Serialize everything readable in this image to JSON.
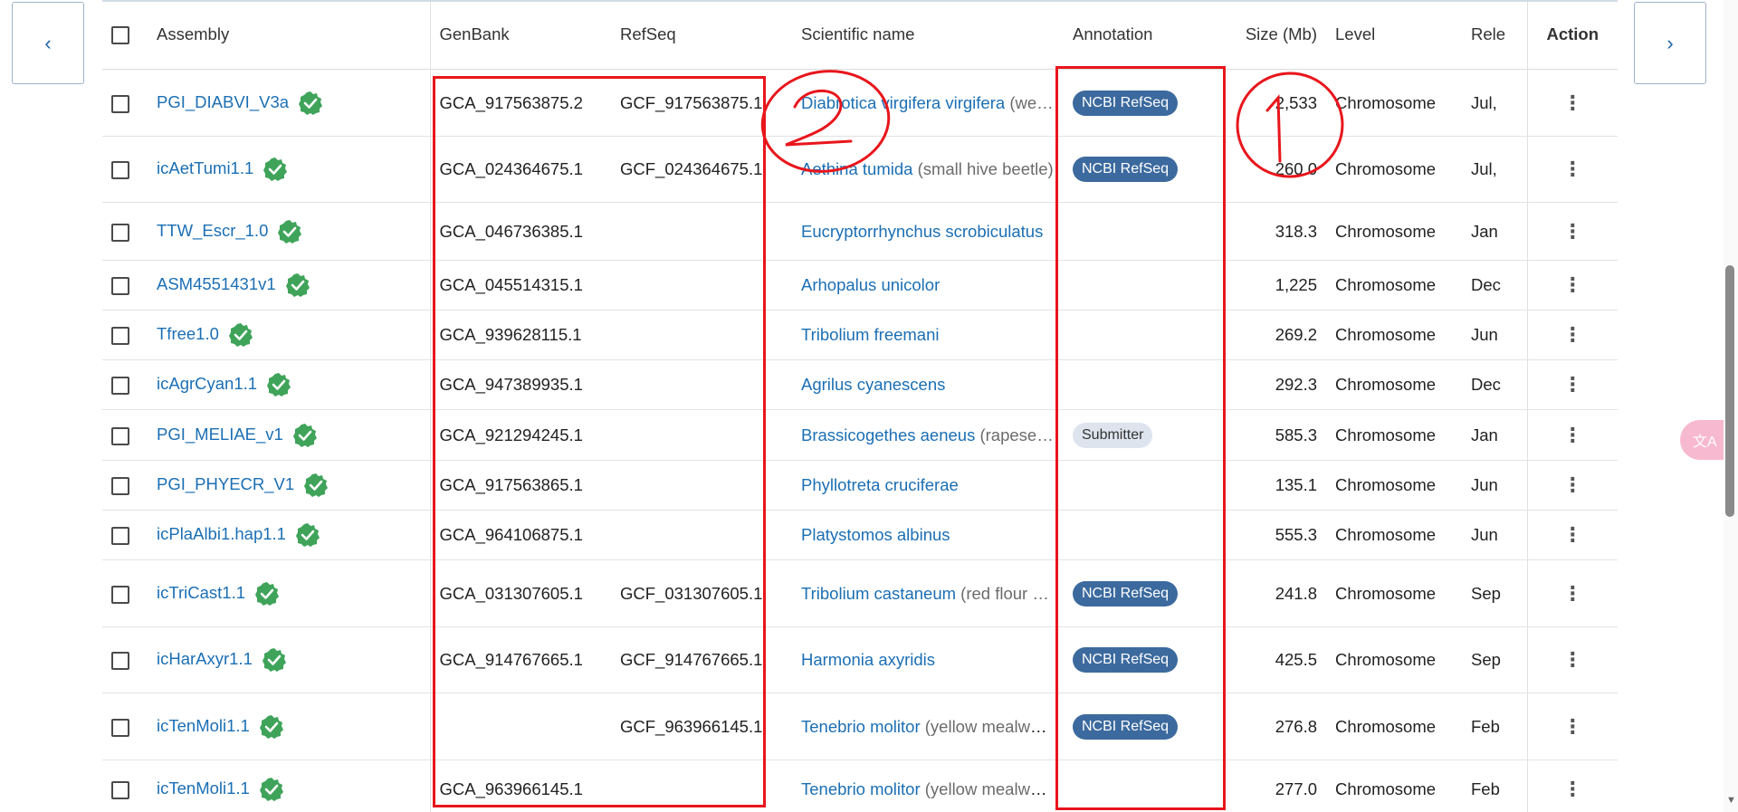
{
  "nav": {
    "prev_icon": "‹",
    "next_icon": "›"
  },
  "columns": {
    "assembly": "Assembly",
    "genbank": "GenBank",
    "refseq": "RefSeq",
    "scientific_name": "Scientific name",
    "annotation": "Annotation",
    "size": "Size (Mb)",
    "level": "Level",
    "release": "Rele",
    "action": "Action"
  },
  "rows": [
    {
      "assembly": "PGI_DIABVI_V3a",
      "genbank": "GCA_917563875.2",
      "refseq": "GCF_917563875.1",
      "sci": "Diabrotica virgifera virgifera",
      "common": "(we…",
      "annotation": "NCBI RefSeq",
      "size": "2,533",
      "level": "Chromosome",
      "release": "Jul,"
    },
    {
      "assembly": "icAetTumi1.1",
      "genbank": "GCA_024364675.1",
      "refseq": "GCF_024364675.1",
      "sci": "Aethina tumida",
      "common": "(small hive beetle)",
      "annotation": "NCBI RefSeq",
      "size": "260.0",
      "level": "Chromosome",
      "release": "Jul,"
    },
    {
      "assembly": "TTW_Escr_1.0",
      "genbank": "GCA_046736385.1",
      "refseq": "",
      "sci": "Eucryptorrhynchus scrobiculatus",
      "common": "",
      "annotation": "",
      "size": "318.3",
      "level": "Chromosome",
      "release": "Jan"
    },
    {
      "assembly": "ASM4551431v1",
      "genbank": "GCA_045514315.1",
      "refseq": "",
      "sci": "Arhopalus unicolor",
      "common": "",
      "annotation": "",
      "size": "1,225",
      "level": "Chromosome",
      "release": "Dec"
    },
    {
      "assembly": "Tfree1.0",
      "genbank": "GCA_939628115.1",
      "refseq": "",
      "sci": "Tribolium freemani",
      "common": "",
      "annotation": "",
      "size": "269.2",
      "level": "Chromosome",
      "release": "Jun"
    },
    {
      "assembly": "icAgrCyan1.1",
      "genbank": "GCA_947389935.1",
      "refseq": "",
      "sci": "Agrilus cyanescens",
      "common": "",
      "annotation": "",
      "size": "292.3",
      "level": "Chromosome",
      "release": "Dec"
    },
    {
      "assembly": "PGI_MELIAE_v1",
      "genbank": "GCA_921294245.1",
      "refseq": "",
      "sci": "Brassicogethes aeneus",
      "common": "(rapese…",
      "annotation": "Submitter",
      "size": "585.3",
      "level": "Chromosome",
      "release": "Jan"
    },
    {
      "assembly": "PGI_PHYECR_V1",
      "genbank": "GCA_917563865.1",
      "refseq": "",
      "sci": "Phyllotreta cruciferae",
      "common": "",
      "annotation": "",
      "size": "135.1",
      "level": "Chromosome",
      "release": "Jun"
    },
    {
      "assembly": "icPlaAlbi1.hap1.1",
      "genbank": "GCA_964106875.1",
      "refseq": "",
      "sci": "Platystomos albinus",
      "common": "",
      "annotation": "",
      "size": "555.3",
      "level": "Chromosome",
      "release": "Jun"
    },
    {
      "assembly": "icTriCast1.1",
      "genbank": "GCA_031307605.1",
      "refseq": "GCF_031307605.1",
      "sci": "Tribolium castaneum",
      "common": "(red flour …",
      "annotation": "NCBI RefSeq",
      "size": "241.8",
      "level": "Chromosome",
      "release": "Sep"
    },
    {
      "assembly": "icHarAxyr1.1",
      "genbank": "GCA_914767665.1",
      "refseq": "GCF_914767665.1",
      "sci": "Harmonia axyridis",
      "common": "",
      "annotation": "NCBI RefSeq",
      "size": "425.5",
      "level": "Chromosome",
      "release": "Sep"
    },
    {
      "assembly": "icTenMoli1.1",
      "genbank": "",
      "refseq": "GCF_963966145.1",
      "sci": "Tenebrio molitor",
      "common": "(yellow mealwo…",
      "annotation": "NCBI RefSeq",
      "size": "276.8",
      "level": "Chromosome",
      "release": "Feb"
    },
    {
      "assembly": "icTenMoli1.1",
      "genbank": "GCA_963966145.1",
      "refseq": "",
      "sci": "Tenebrio molitor",
      "common": "(yellow mealwo…",
      "annotation": "",
      "size": "277.0",
      "level": "Chromosome",
      "release": "Feb"
    }
  ],
  "icons": {
    "verified": "verified-check-icon",
    "row_menu": "kebab-menu-icon",
    "float_tool": "translate-icon"
  },
  "colors": {
    "link": "#1b6fb4",
    "refseq_badge": "#3c6a9e",
    "submitter_badge": "#dde4ee",
    "verified": "#3fa45a",
    "annotation_marks": "#e8161c"
  }
}
